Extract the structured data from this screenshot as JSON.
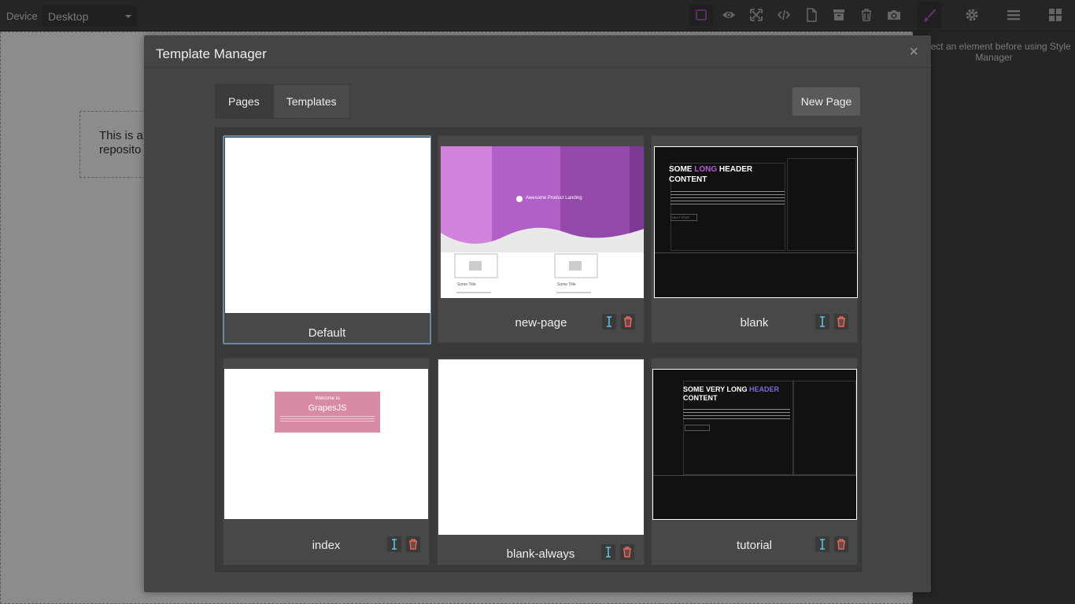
{
  "topbar": {
    "device_label": "Device",
    "device_value": "Desktop",
    "buttons": [
      "square-icon",
      "eye-icon",
      "fullscreen-icon",
      "code-icon",
      "file-icon",
      "archive-icon",
      "trash-icon",
      "camera-icon",
      "brush-icon",
      "gear-icon",
      "menu-icon",
      "blocks-icon"
    ]
  },
  "canvas": {
    "text_line1": "This is a",
    "text_line2": "reposito"
  },
  "right_panel": {
    "message": "Select an element before using Style Manager"
  },
  "modal": {
    "title": "Template Manager",
    "close": "×",
    "tabs": [
      {
        "label": "Pages",
        "active": true
      },
      {
        "label": "Templates",
        "active": false
      }
    ],
    "new_page_label": "New Page",
    "pages": [
      {
        "name": "Default",
        "selected": true
      },
      {
        "name": "new-page"
      },
      {
        "name": "blank"
      },
      {
        "name": "index"
      },
      {
        "name": "blank-always"
      },
      {
        "name": "tutorial"
      }
    ]
  },
  "thumbnails": {
    "new_page": {
      "title": "Awesome Product Landing",
      "caption1": "Some Title",
      "caption2": "Some Title"
    },
    "blank": {
      "heading_pre": "SOME ",
      "heading_accent": "LONG",
      "heading_post": " HEADER CONTENT",
      "button": "NEXT STEP"
    },
    "index": {
      "welcome": "Welcome to",
      "brand": "GrapesJS"
    },
    "tutorial": {
      "heading_pre": "SOME VERY LONG ",
      "heading_accent": "HEADER",
      "heading_post": " CONTENT"
    }
  },
  "colors": {
    "accent": "#b15fd6",
    "selected_border": "#6d86a8",
    "rename_icon": "#5fc2d8",
    "delete_icon": "#e5695c"
  }
}
